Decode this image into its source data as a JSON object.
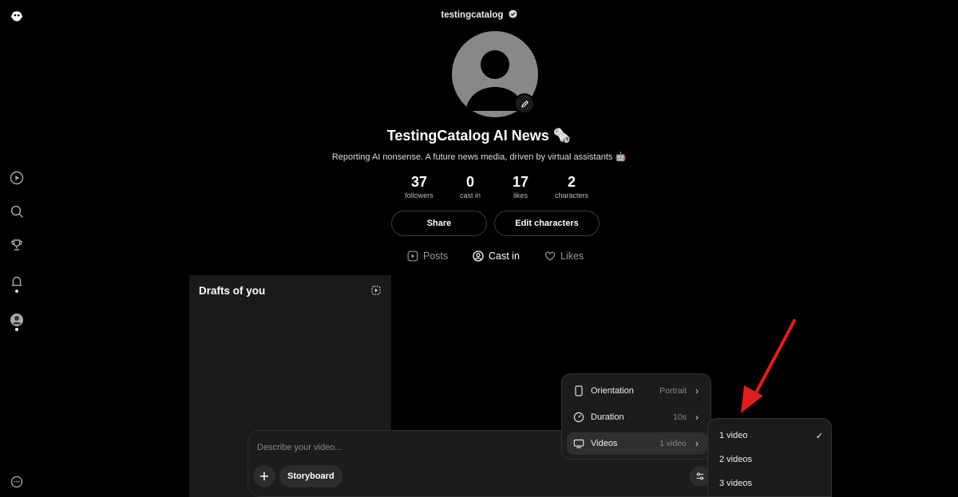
{
  "profile": {
    "username": "testingcatalog",
    "display_name": "TestingCatalog AI News 🗞️",
    "bio": "Reporting AI nonsense. A future news media, driven by virtual assistants 🤖"
  },
  "stats": [
    {
      "value": "37",
      "label": "followers"
    },
    {
      "value": "0",
      "label": "cast in"
    },
    {
      "value": "17",
      "label": "likes"
    },
    {
      "value": "2",
      "label": "characters"
    }
  ],
  "actions": {
    "share": "Share",
    "edit_characters": "Edit characters"
  },
  "tabs": [
    {
      "label": "Posts",
      "icon": "play-square-icon",
      "active": false
    },
    {
      "label": "Cast in",
      "icon": "person-circle-icon",
      "active": true
    },
    {
      "label": "Likes",
      "icon": "heart-icon",
      "active": false
    }
  ],
  "drafts": {
    "title": "Drafts of you"
  },
  "composer": {
    "placeholder": "Describe your video...",
    "storyboard_label": "Storyboard"
  },
  "settings_menu": {
    "items": [
      {
        "label": "Orientation",
        "value": "Portrait",
        "icon": "phone-icon"
      },
      {
        "label": "Duration",
        "value": "10s",
        "icon": "clock-icon"
      },
      {
        "label": "Videos",
        "value": "1 video",
        "icon": "monitor-icon"
      }
    ]
  },
  "videos_submenu": {
    "options": [
      "1 video",
      "2 videos",
      "3 videos"
    ],
    "selected": "1 video"
  },
  "colors": {
    "background": "#000000",
    "card": "#1a1a1a",
    "annotation_arrow": "#e01e1e"
  }
}
